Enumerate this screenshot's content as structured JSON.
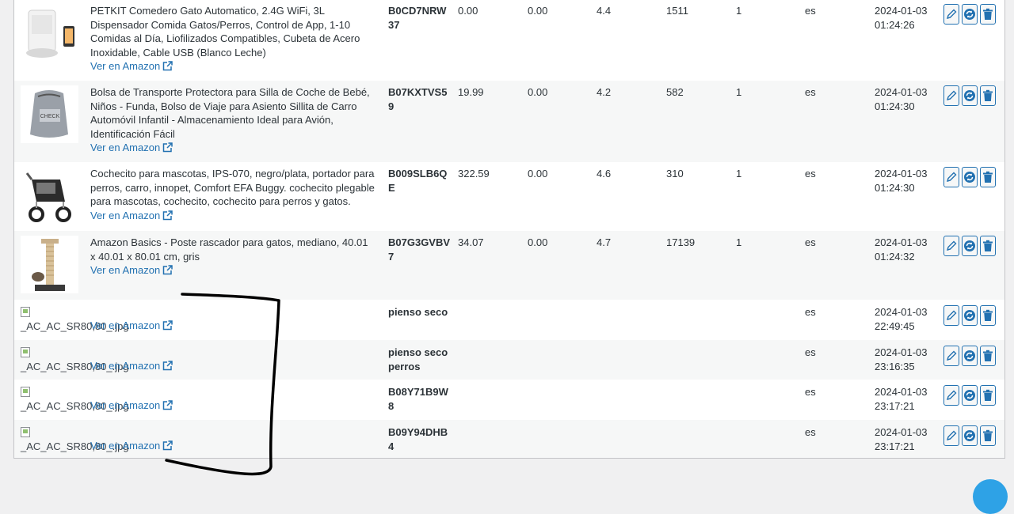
{
  "link_label": "Ver en Amazon",
  "rows": [
    {
      "title": "PETKIT Comedero Gato Automatico, 2.4G WiFi, 3L Dispensador Comida Gatos/Perros, Control de App, 1-10 Comidas al Día, Liofilizados Compatibles, Cubeta de Acero Inoxidable, Cable USB (Blanco Leche)",
      "asin": "B0CD7NRW37",
      "price": "0.00",
      "old_price": "0.00",
      "rating": "4.4",
      "reviews": "1511",
      "qty": "1",
      "lang": "es",
      "date": "2024-01-03",
      "time": "01:24:26"
    },
    {
      "title": "Bolsa de Transporte Protectora para Silla de Coche de Bebé, Niños - Funda, Bolso de Viaje para Asiento Sillita de Carro Automóvil Infantil - Almacenamiento Ideal para Avión, Identificación Fácil",
      "asin": "B07KXTVS59",
      "price": "19.99",
      "old_price": "0.00",
      "rating": "4.2",
      "reviews": "582",
      "qty": "1",
      "lang": "es",
      "date": "2024-01-03",
      "time": "01:24:30"
    },
    {
      "title": "Cochecito para mascotas, IPS-070, negro/plata, portador para perros, carro, innopet, Comfort EFA Buggy. cochecito plegable para mascotas, cochecito, cochecito para perros y gatos.",
      "asin": "B009SLB6QE",
      "price": "322.59",
      "old_price": "0.00",
      "rating": "4.6",
      "reviews": "310",
      "qty": "1",
      "lang": "es",
      "date": "2024-01-03",
      "time": "01:24:30"
    },
    {
      "title": "Amazon Basics - Poste rascador para gatos, mediano, 40.01 x 40.01 x 80.01 cm, gris",
      "asin": "B07G3GVBV7",
      "price": "34.07",
      "old_price": "0.00",
      "rating": "4.7",
      "reviews": "17139",
      "qty": "1",
      "lang": "es",
      "date": "2024-01-03",
      "time": "01:24:32"
    },
    {
      "broken_alt": "_AC_AC_SR80,80_.jpg",
      "asin": "pienso seco",
      "lang": "es",
      "date": "2024-01-03",
      "time": "22:49:45"
    },
    {
      "broken_alt": "_AC_AC_SR80,80_.jpg",
      "asin": "pienso seco perros",
      "lang": "es",
      "date": "2024-01-03",
      "time": "23:16:35"
    },
    {
      "broken_alt": "_AC_AC_SR80,80_.jpg",
      "asin": "B08Y71B9W8",
      "lang": "es",
      "date": "2024-01-03",
      "time": "23:17:21"
    },
    {
      "broken_alt": "_AC_AC_SR80,80_.jpg",
      "asin": "B09Y94DHB4",
      "lang": "es",
      "date": "2024-01-03",
      "time": "23:17:21"
    }
  ],
  "icons": {
    "edit": "pencil-icon",
    "refresh": "refresh-icon",
    "delete": "trash-icon",
    "external": "external-link-icon"
  },
  "colors": {
    "link": "#2271b1",
    "annotation": "#000000",
    "fab": "#2ea2e6"
  }
}
